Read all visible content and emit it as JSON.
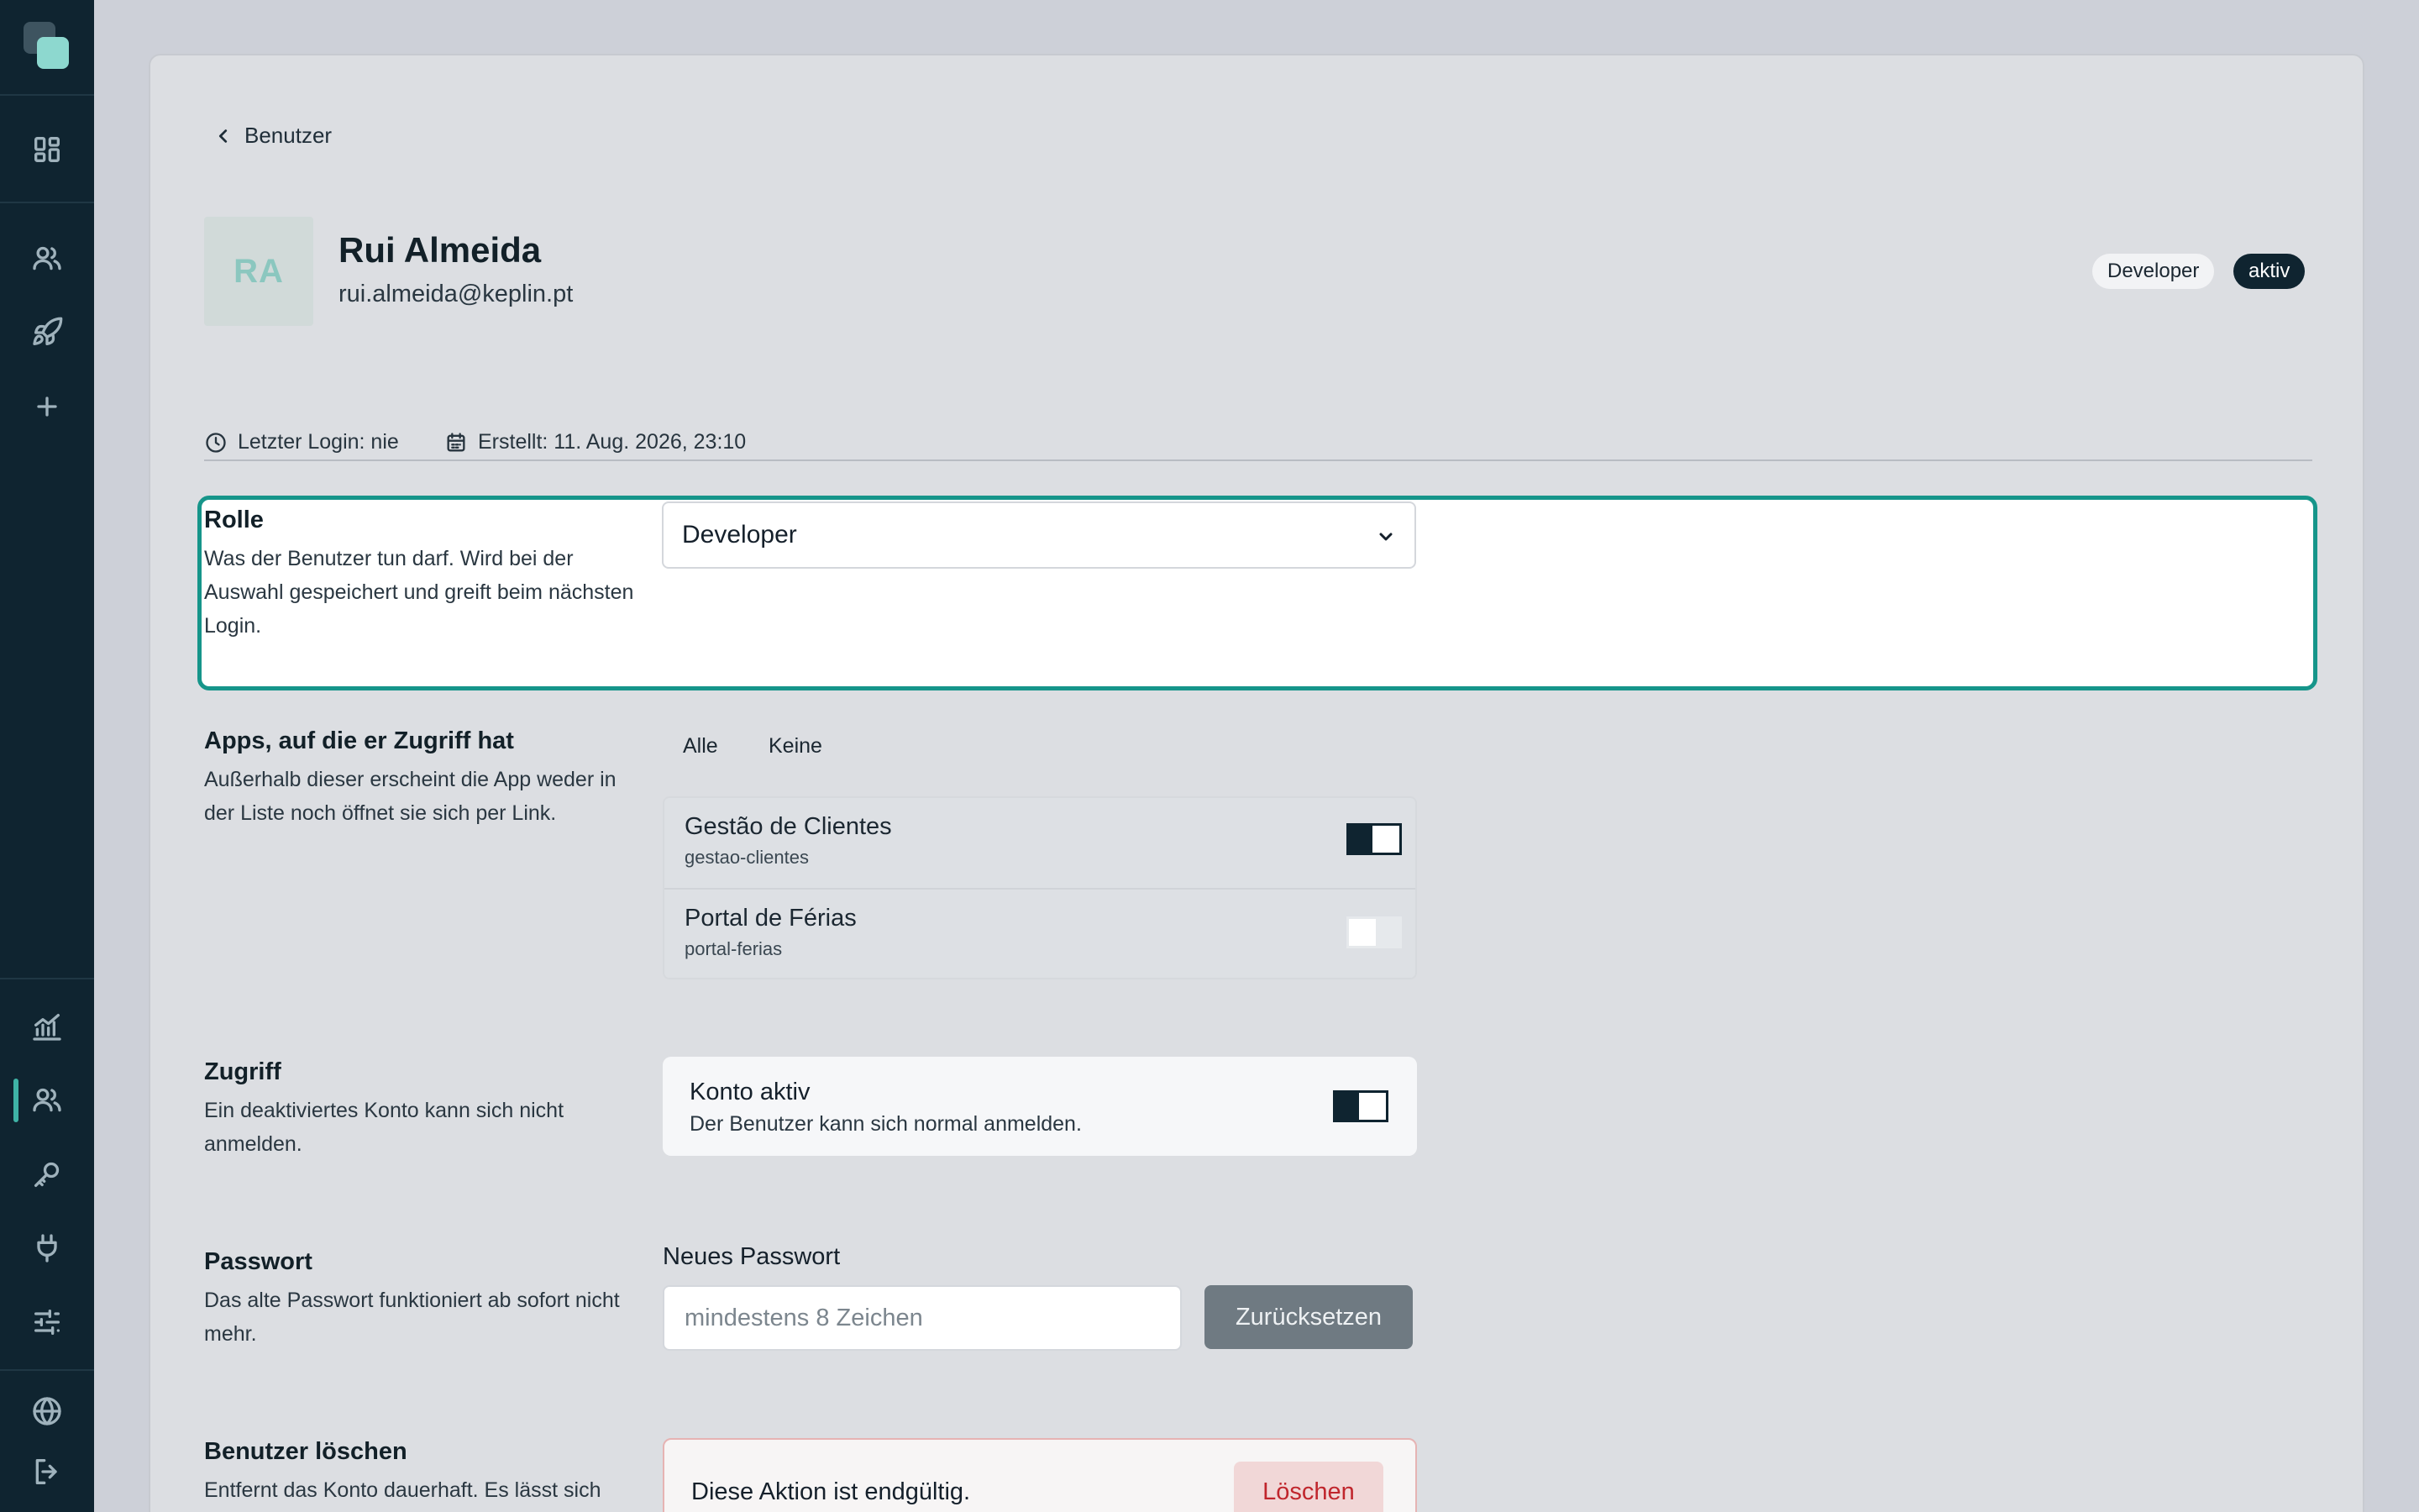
{
  "header": {
    "back_label": "Benutzer"
  },
  "user": {
    "initials": "RA",
    "name": "Rui Almeida",
    "email": "rui.almeida@keplin.pt",
    "role_badge": "Developer",
    "status_badge": "aktiv",
    "last_login": "Letzter Login: nie",
    "created": "Erstellt: 11. Aug. 2026, 23:10"
  },
  "role_section": {
    "title": "Rolle",
    "description": "Was der Benutzer tun darf. Wird bei der Auswahl gespeichert und greift beim nächsten Login.",
    "selected": "Developer"
  },
  "apps_section": {
    "title": "Apps, auf die er Zugriff hat",
    "description": "Außerhalb dieser erscheint die App weder in der Liste noch öffnet sie sich per Link.",
    "all_label": "Alle",
    "none_label": "Keine",
    "apps": [
      {
        "name": "Gestão de Clientes",
        "slug": "gestao-clientes",
        "enabled": true
      },
      {
        "name": "Portal de Férias",
        "slug": "portal-ferias",
        "enabled": false
      }
    ]
  },
  "access_section": {
    "title": "Zugriff",
    "description": "Ein deaktiviertes Konto kann sich nicht anmelden.",
    "toggle_title": "Konto aktiv",
    "toggle_subtitle": "Der Benutzer kann sich normal anmelden.",
    "enabled": true
  },
  "password_section": {
    "title": "Passwort",
    "description": "Das alte Passwort funktioniert ab sofort nicht mehr.",
    "field_label": "Neues Passwort",
    "placeholder": "mindestens 8 Zeichen",
    "reset_label": "Zurücksetzen"
  },
  "delete_section": {
    "title": "Benutzer löschen",
    "description": "Entfernt das Konto dauerhaft. Es lässt sich",
    "warning": "Diese Aktion ist endgültig.",
    "delete_label": "Löschen"
  },
  "colors": {
    "sidebar": "#0f2430",
    "accent": "#16958a",
    "danger": "#c0262d"
  },
  "sidebar_icons": [
    "grid-icon",
    "users-icon",
    "rocket-icon",
    "plus-icon",
    "chart-icon",
    "users-icon",
    "key-icon",
    "plug-icon",
    "sliders-icon",
    "globe-icon",
    "logout-icon"
  ]
}
